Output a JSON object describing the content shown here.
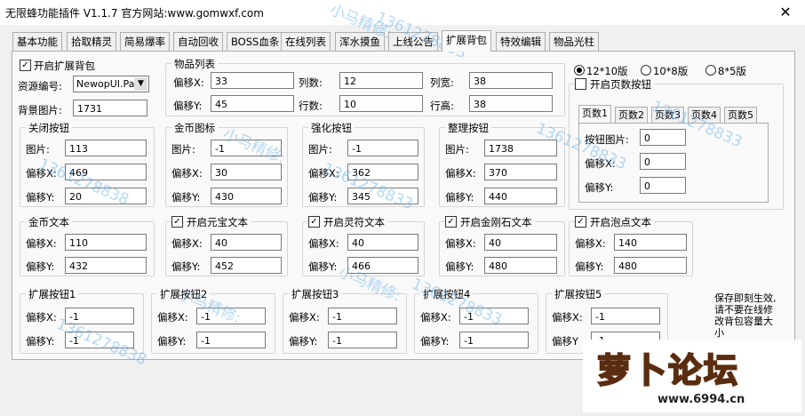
{
  "window": {
    "title": "无限蜂功能插件 V1.1.7  官方网站:www.gomwxf.com",
    "close": "✕"
  },
  "tabs": [
    "基本功能",
    "拾取精灵",
    "简易爆率",
    "自动回收",
    "BOSS血条",
    "在线列表",
    "浑水摸鱼",
    "上线公告",
    "扩展背包",
    "特效编辑",
    "物品光柱"
  ],
  "bag": {
    "enable_label": "开启扩展背包",
    "enable_checked": "✓",
    "res_label": "资源编号:",
    "res_value": "NewopUI.Pak",
    "res_arrow": "▼",
    "bg_label": "背景图片:",
    "bg_value": "1731"
  },
  "item_list": {
    "title": "物品列表",
    "offset_x_label": "偏移X:",
    "offset_x": "33",
    "offset_y_label": "偏移Y:",
    "offset_y": "45",
    "cols_label": "列数:",
    "cols": "12",
    "rows_label": "行数:",
    "rows": "10",
    "col_w_label": "列宽:",
    "col_w": "38",
    "row_h_label": "行高:",
    "row_h": "38"
  },
  "modes": {
    "m1": "12*10版",
    "m2": "10*8版",
    "m3": "8*5版"
  },
  "close_btn": {
    "title": "关闭按钮",
    "img_label": "图片:",
    "img": "113",
    "x_label": "偏移X:",
    "x": "469",
    "y_label": "偏移Y:",
    "y": "20"
  },
  "gold_icon": {
    "title": "金币图标",
    "img_label": "图片:",
    "img": "-1",
    "x_label": "偏移X:",
    "x": "30",
    "y_label": "偏移Y:",
    "y": "430"
  },
  "enhance_btn": {
    "title": "强化按钮",
    "img_label": "图片:",
    "img": "-1",
    "x_label": "偏移X:",
    "x": "362",
    "y_label": "偏移Y:",
    "y": "345"
  },
  "sort_btn": {
    "title": "整理按钮",
    "img_label": "图片:",
    "img": "1738",
    "x_label": "偏移X:",
    "x": "370",
    "y_label": "偏移Y:",
    "y": "440"
  },
  "page_btn": {
    "enable_label": "开启页数按钮",
    "tabs": [
      "页数1",
      "页数2",
      "页数3",
      "页数4",
      "页数5"
    ],
    "img_label": "按钮图片:",
    "img": "0",
    "x_label": "偏移X:",
    "x": "0",
    "y_label": "偏移Y:",
    "y": "0"
  },
  "gold_text": {
    "title": "金币文本",
    "x_label": "偏移X:",
    "x": "110",
    "y_label": "偏移Y:",
    "y": "432"
  },
  "yuanbao_text": {
    "title": "开启元宝文本",
    "checked": "✓",
    "x_label": "偏移X:",
    "x": "40",
    "y_label": "偏移Y:",
    "y": "452"
  },
  "lingfu_text": {
    "title": "开启灵符文本",
    "checked": "✓",
    "x_label": "偏移X:",
    "x": "40",
    "y_label": "偏移Y:",
    "y": "466"
  },
  "diamond_text": {
    "title": "开启金刚石文本",
    "checked": "✓",
    "x_label": "偏移X:",
    "x": "40",
    "y_label": "偏移Y:",
    "y": "480"
  },
  "bubble_text": {
    "title": "开启泡点文本",
    "checked": "✓",
    "x_label": "偏移X:",
    "x": "140",
    "y_label": "偏移Y:",
    "y": "480"
  },
  "ext_buttons": [
    {
      "title": "扩展按钮1",
      "x_label": "偏移X:",
      "x": "-1",
      "y_label": "偏移Y:",
      "y": "-1"
    },
    {
      "title": "扩展按钮2",
      "x_label": "偏移X:",
      "x": "-1",
      "y_label": "偏移Y:",
      "y": "-1"
    },
    {
      "title": "扩展按钮3",
      "x_label": "偏移X:",
      "x": "-1",
      "y_label": "偏移Y:",
      "y": "-1"
    },
    {
      "title": "扩展按钮4",
      "x_label": "偏移X:",
      "x": "-1",
      "y_label": "偏移Y:",
      "y": "-1"
    },
    {
      "title": "扩展按钮5",
      "x_label": "偏移X:",
      "x": "-1",
      "y_label": "偏移Y",
      "y": "-1"
    }
  ],
  "note": "保存即刻生效,请不要在线修改背包容量大小",
  "watermark": {
    "text1": "小马精修:",
    "text2": "1361278833",
    "text3": "1361278838"
  },
  "logo": {
    "name": "萝卜论坛",
    "url": "www.6994.cn"
  },
  "colors": {
    "watermark": "#5aaae6",
    "logo_orange": "#f3a64b"
  }
}
